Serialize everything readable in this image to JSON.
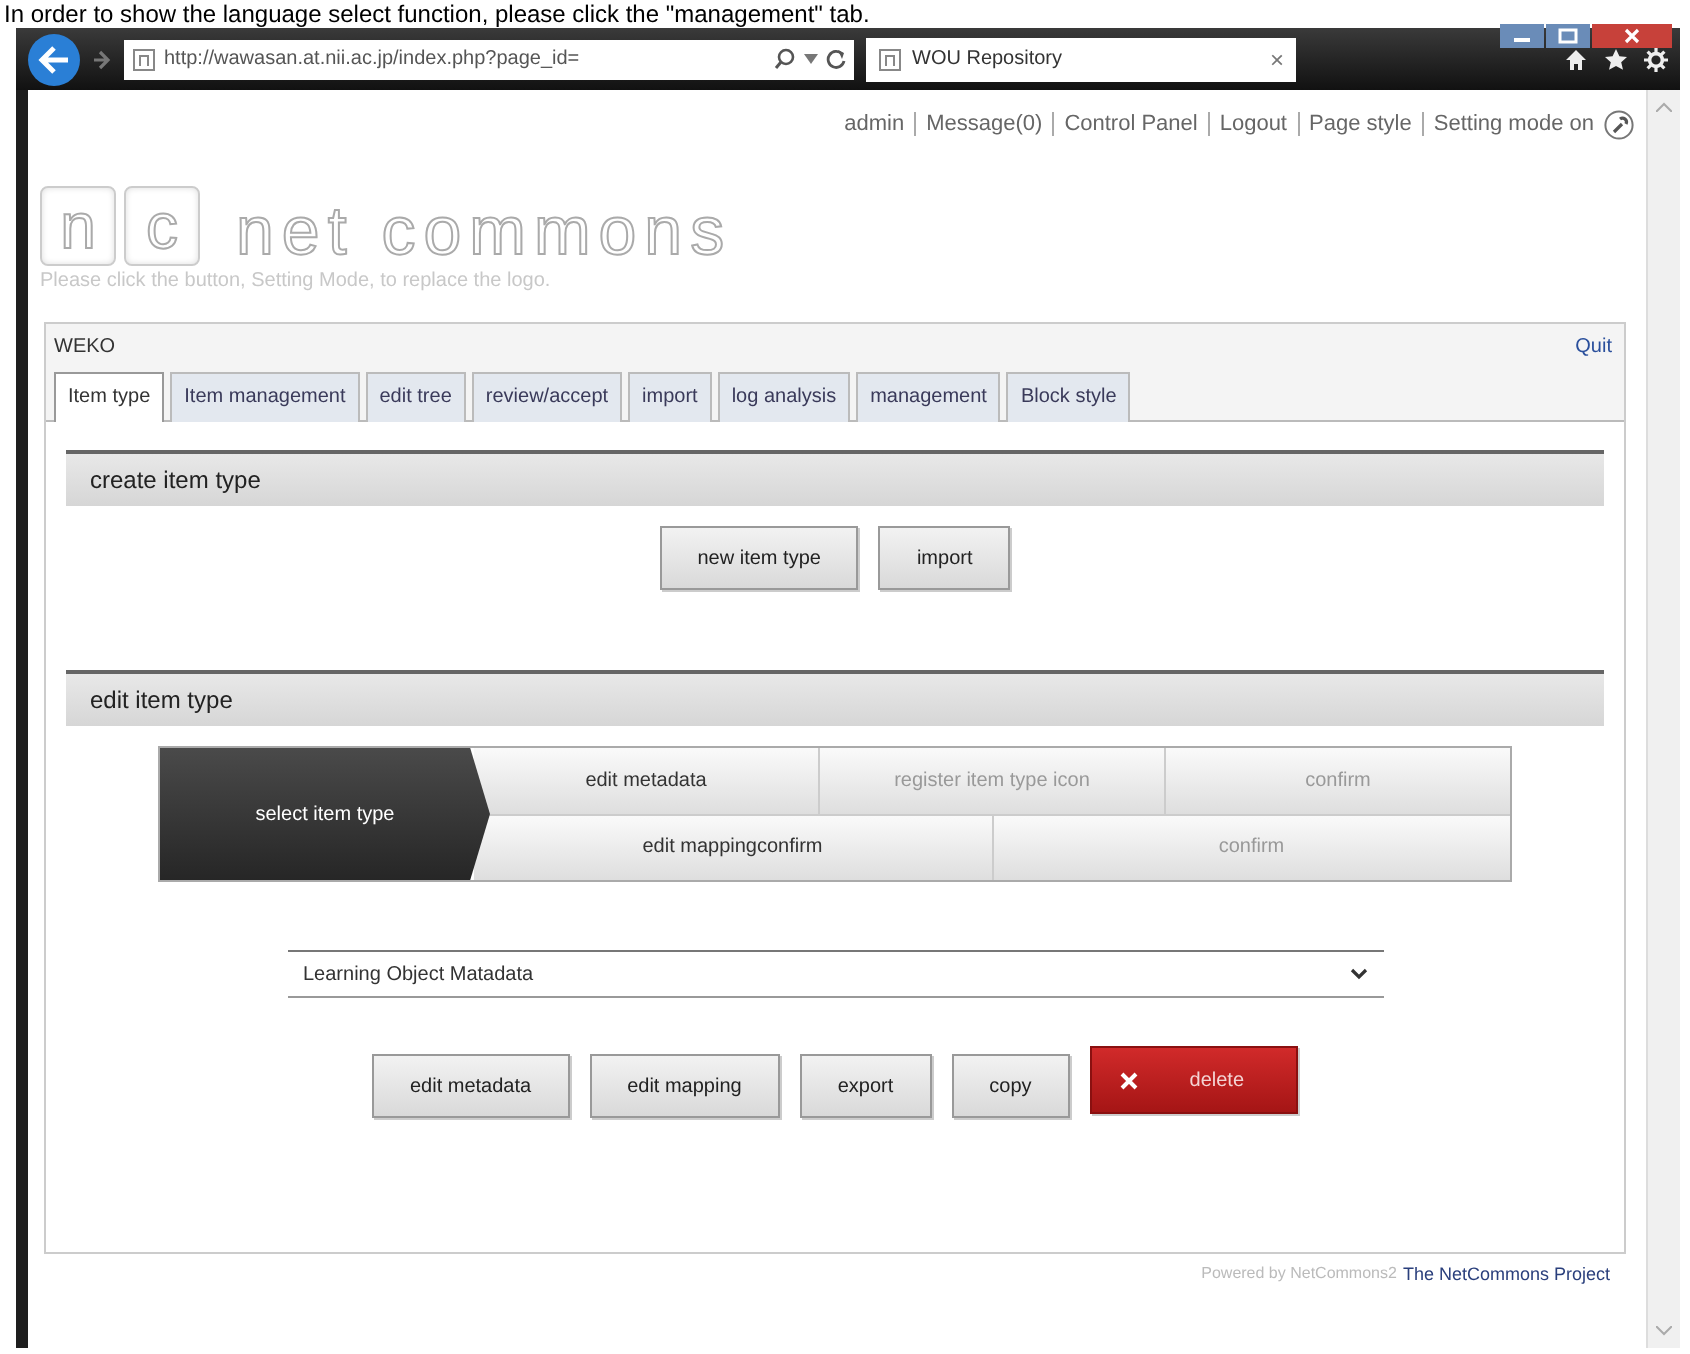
{
  "caption": "In order to show the language select function, please click the \"management\" tab.",
  "browser": {
    "address": "http://wawasan.at.nii.ac.jp/index.php?page_id=",
    "tab_title": "WOU Repository",
    "tab_close": "×"
  },
  "header_links": [
    "admin",
    "Message(0)",
    "Control Panel",
    "Logout",
    "Page style",
    "Setting mode on"
  ],
  "logo": {
    "letters": [
      "n",
      "c"
    ],
    "text": "net commons",
    "hint": "Please click the button, Setting Mode, to replace the logo."
  },
  "module": {
    "title": "WEKO",
    "quit": "Quit"
  },
  "tabs": [
    {
      "label": "Item type",
      "selected": true
    },
    {
      "label": "Item management",
      "selected": false
    },
    {
      "label": "edit tree",
      "selected": false
    },
    {
      "label": "review/accept",
      "selected": false
    },
    {
      "label": "import",
      "selected": false
    },
    {
      "label": "log analysis",
      "selected": false
    },
    {
      "label": "management",
      "selected": false
    },
    {
      "label": "Block style",
      "selected": false
    }
  ],
  "create_section": {
    "title": "create item type",
    "buttons": [
      "new item type",
      "import"
    ]
  },
  "edit_section": {
    "title": "edit item type",
    "current_step": "select item type",
    "step_rows": [
      [
        {
          "label": "edit metadata",
          "disabled": false
        },
        {
          "label": "register item type icon",
          "disabled": true
        },
        {
          "label": "confirm",
          "disabled": true
        }
      ],
      [
        {
          "label": "edit mappingconfirm",
          "disabled": false
        },
        {
          "label": "confirm",
          "disabled": true
        }
      ]
    ],
    "select": {
      "value": "Learning Object Matadata"
    },
    "buttons": [
      {
        "label": "edit metadata",
        "kind": "normal"
      },
      {
        "label": "edit mapping",
        "kind": "normal"
      },
      {
        "label": "export",
        "kind": "normal"
      },
      {
        "label": "copy",
        "kind": "normal"
      },
      {
        "label": "delete",
        "kind": "danger"
      }
    ]
  },
  "footer": {
    "powered_by": "Powered by NetCommons2",
    "project": "The NetCommons Project"
  }
}
